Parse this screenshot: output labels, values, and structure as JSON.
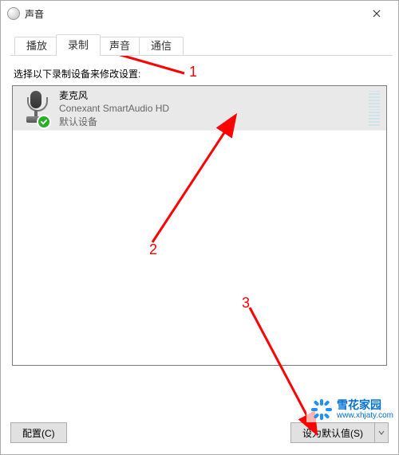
{
  "window": {
    "title": "声音"
  },
  "tabs": {
    "items": [
      "播放",
      "录制",
      "声音",
      "通信"
    ],
    "active": 1
  },
  "instruction": "选择以下录制设备来修改设置:",
  "devices": [
    {
      "name": "麦克风",
      "driver": "Conexant SmartAudio HD",
      "status": "默认设备",
      "selected": true,
      "default": true
    }
  ],
  "buttons": {
    "configure": "配置(C)",
    "setDefault": "设为默认值(S)"
  },
  "annotations": {
    "a1": "1",
    "a2": "2",
    "a3": "3"
  },
  "watermark": {
    "name": "雪花家园",
    "url": "www.xhjaty.com"
  }
}
